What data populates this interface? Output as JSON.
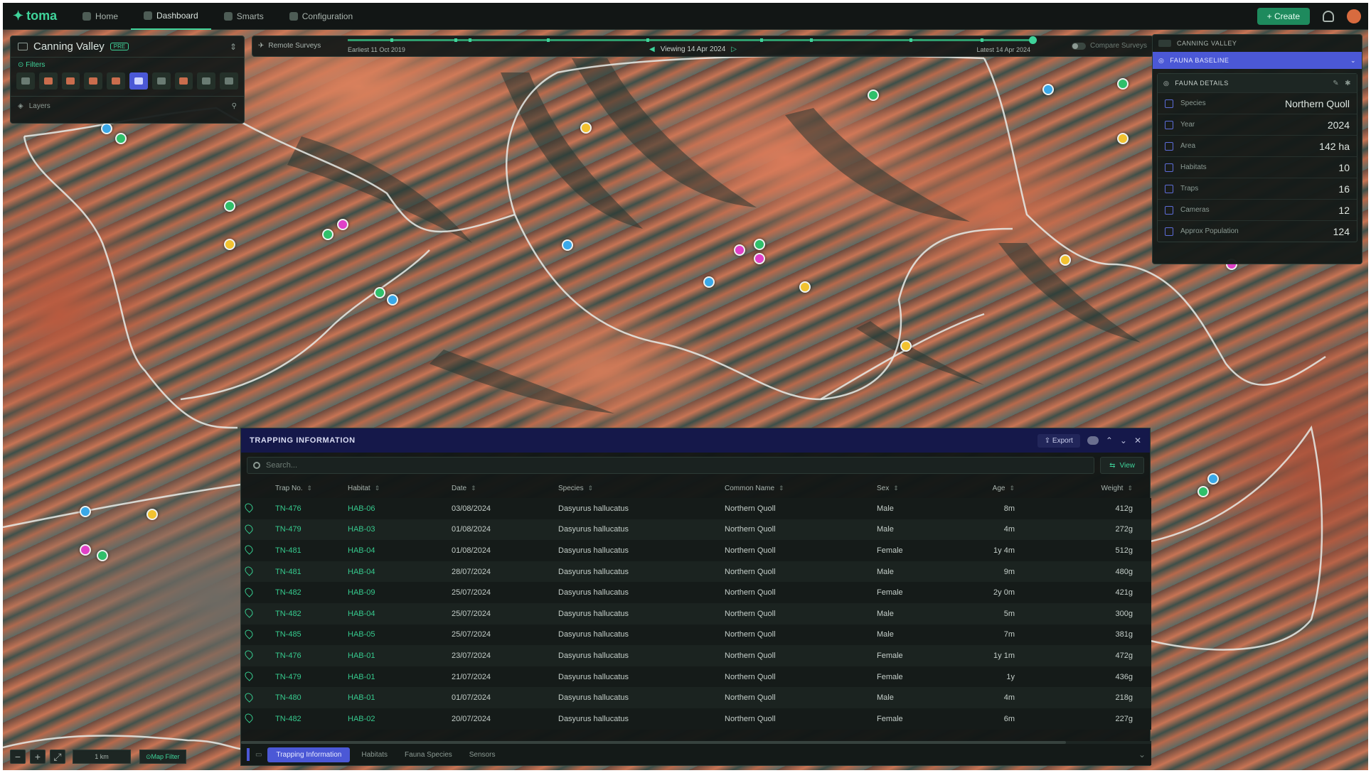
{
  "nav": {
    "logo": "toma",
    "items": [
      {
        "label": "Home"
      },
      {
        "label": "Dashboard"
      },
      {
        "label": "Smarts"
      },
      {
        "label": "Configuration"
      }
    ],
    "create_label": "Create"
  },
  "left_panel": {
    "title": "Canning Valley",
    "badge": "PRE",
    "filters_label": "Filters",
    "layers_label": "Layers"
  },
  "timeline": {
    "remote_surveys_label": "Remote Surveys",
    "earliest": "Earliest 11 Oct 2019",
    "viewing": "Viewing 14 Apr 2024",
    "latest": "Latest 14 Apr 2024",
    "compare_label": "Compare Surveys"
  },
  "right_panel": {
    "site_label": "CANNING VALLEY",
    "baseline_label": "FAUNA BASELINE",
    "details_label": "FAUNA DETAILS",
    "rows": [
      {
        "label": "Species",
        "value": "Northern Quoll"
      },
      {
        "label": "Year",
        "value": "2024"
      },
      {
        "label": "Area",
        "value": "142 ha"
      },
      {
        "label": "Habitats",
        "value": "10"
      },
      {
        "label": "Traps",
        "value": "16"
      },
      {
        "label": "Cameras",
        "value": "12"
      },
      {
        "label": "Approx Population",
        "value": "124"
      }
    ]
  },
  "map_controls": {
    "scale": "1 km",
    "filter_label": "Map Filter"
  },
  "trapping": {
    "title": "TRAPPING INFORMATION",
    "export_label": "Export",
    "search_placeholder": "Search...",
    "view_label": "View",
    "columns": [
      "Trap No.",
      "Habitat",
      "Date",
      "Species",
      "Common Name",
      "Sex",
      "Age",
      "Weight"
    ],
    "rows": [
      [
        "TN-476",
        "HAB-06",
        "03/08/2024",
        "Dasyurus hallucatus",
        "Northern Quoll",
        "Male",
        "8m",
        "412g"
      ],
      [
        "TN-479",
        "HAB-03",
        "01/08/2024",
        "Dasyurus hallucatus",
        "Northern Quoll",
        "Male",
        "4m",
        "272g"
      ],
      [
        "TN-481",
        "HAB-04",
        "01/08/2024",
        "Dasyurus hallucatus",
        "Northern Quoll",
        "Female",
        "1y 4m",
        "512g"
      ],
      [
        "TN-481",
        "HAB-04",
        "28/07/2024",
        "Dasyurus hallucatus",
        "Northern Quoll",
        "Male",
        "9m",
        "480g"
      ],
      [
        "TN-482",
        "HAB-09",
        "25/07/2024",
        "Dasyurus hallucatus",
        "Northern Quoll",
        "Female",
        "2y 0m",
        "421g"
      ],
      [
        "TN-482",
        "HAB-04",
        "25/07/2024",
        "Dasyurus hallucatus",
        "Northern Quoll",
        "Male",
        "5m",
        "300g"
      ],
      [
        "TN-485",
        "HAB-05",
        "25/07/2024",
        "Dasyurus hallucatus",
        "Northern Quoll",
        "Male",
        "7m",
        "381g"
      ],
      [
        "TN-476",
        "HAB-01",
        "23/07/2024",
        "Dasyurus hallucatus",
        "Northern Quoll",
        "Female",
        "1y 1m",
        "472g"
      ],
      [
        "TN-479",
        "HAB-01",
        "21/07/2024",
        "Dasyurus hallucatus",
        "Northern Quoll",
        "Female",
        "1y",
        "436g"
      ],
      [
        "TN-480",
        "HAB-01",
        "01/07/2024",
        "Dasyurus hallucatus",
        "Northern Quoll",
        "Male",
        "4m",
        "218g"
      ],
      [
        "TN-482",
        "HAB-02",
        "20/07/2024",
        "Dasyurus hallucatus",
        "Northern Quoll",
        "Female",
        "6m",
        "227g"
      ]
    ],
    "tabs": [
      "Trapping Information",
      "Habitats",
      "Fauna Species",
      "Sensors"
    ]
  },
  "colors": {
    "accent": "#3fd39a",
    "highlight": "#4b58d6",
    "pin_green": "#2fbf6a",
    "pin_blue": "#3aa8e8",
    "pin_yellow": "#f2c230",
    "pin_magenta": "#e040c8"
  }
}
